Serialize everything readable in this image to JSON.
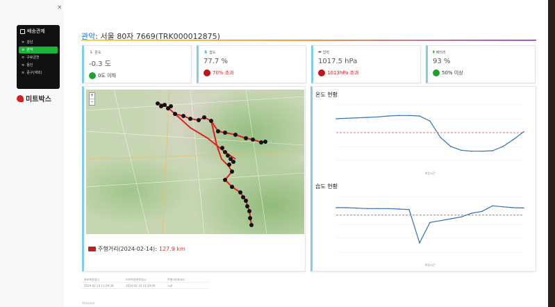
{
  "sidebar": {
    "close": "×",
    "menu_title": "배송관제",
    "items": [
      {
        "label": "강남",
        "active": false
      },
      {
        "label": "관악",
        "active": true
      },
      {
        "label": "구로금천",
        "active": false
      },
      {
        "label": "용인",
        "active": false
      },
      {
        "label": "중구(재외)",
        "active": false
      }
    ],
    "brand": "미트박스"
  },
  "page": {
    "title_prefix": "관악",
    "title_rest": ": 서울 80자 7669(TRK000012875)"
  },
  "cards": [
    {
      "label": "온도",
      "value": "-0.3 도",
      "status": "0도 이하",
      "status_color": "green"
    },
    {
      "label": "습도",
      "value": "77.7 %",
      "status": "70% 초과",
      "status_color": "red"
    },
    {
      "label": "압력",
      "value": "1017.5 hPa",
      "status": "1013hPa 초과",
      "status_color": "red"
    },
    {
      "label": "배터리",
      "value": "93 %",
      "status": "50% 이상",
      "status_color": "green"
    }
  ],
  "map": {
    "zoom_in": "+",
    "zoom_out": "−",
    "distance_label": "주행거리(2024-02-14): ",
    "distance_value": "127.9 km"
  },
  "charts": {
    "temp_title": "온도 현황",
    "hum_title": "습도 현황",
    "xlabel": "측정시간"
  },
  "chart_data": [
    {
      "type": "line",
      "title": "온도 현황",
      "xlabel": "측정시간",
      "threshold": 0,
      "y": [
        3.0,
        3.1,
        3.2,
        3.3,
        3.4,
        3.6,
        3.7,
        3.7,
        3.6,
        2.5,
        -1.0,
        -3.0,
        -3.8,
        -4.0,
        -4.0,
        -3.9,
        -3.0,
        -1.5,
        0.2
      ]
    },
    {
      "type": "line",
      "title": "습도 현황",
      "xlabel": "측정시간",
      "threshold": 70,
      "y": [
        78,
        78,
        77.5,
        77,
        77,
        77,
        76.5,
        76,
        40,
        62,
        64,
        66,
        68,
        72,
        74,
        80,
        79,
        78,
        77.7
      ]
    }
  ],
  "table": {
    "headers": [
      "최초측정일시",
      "미터측정완료일시",
      "주행거리(km)"
    ],
    "row": [
      "2024-02-14 11:59:39",
      "2024-02-14 14:29:00",
      "null"
    ]
  },
  "footer": "Streamlit"
}
